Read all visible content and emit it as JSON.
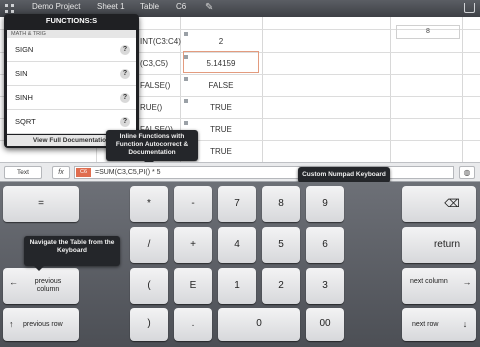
{
  "toolbar": {
    "project": "Demo Project",
    "sheet": "Sheet 1",
    "table": "Table",
    "cell": "C6"
  },
  "sheet": {
    "rows": [
      {
        "formula": "INT(C3:C4)",
        "value": "2"
      },
      {
        "formula": "(C3,C5)",
        "value": "5.14159"
      },
      {
        "formula": "FALSE()",
        "value": "FALSE"
      },
      {
        "formula": "RUE()",
        "value": "TRUE"
      },
      {
        "formula": "FALSE())",
        "value": "TRUE"
      },
      {
        "formula": "",
        "value": "TRUE"
      }
    ],
    "right_value": "8"
  },
  "function_panel": {
    "header": "FUNCTIONS:S",
    "category": "MATH & TRIG",
    "items": [
      {
        "name": "SIGN",
        "help": "?"
      },
      {
        "name": "SIN",
        "help": "?"
      },
      {
        "name": "SINH",
        "help": "?"
      },
      {
        "name": "SQRT",
        "help": "?"
      }
    ],
    "doc_button": "View Full Documentation"
  },
  "callouts": {
    "inline": "Inline Functions with Function Autocorrect & Documentation",
    "numpad": "Custom Numpad Keyboard",
    "navigate": "Navigate the Table from the Keyboard"
  },
  "formula_bar": {
    "text_button": "Text",
    "fx_button": "fx",
    "cell_ref": "C6",
    "formula": "=SUM(C3,C5,PI() * 5"
  },
  "keyboard": {
    "equals": "=",
    "backspace": "⌫",
    "return": "return",
    "previous_column": "previous column",
    "next_column": "next column",
    "previous_row": "previous row",
    "next_row": "next row",
    "keys": {
      "multiply": "*",
      "minus": "-",
      "seven": "7",
      "eight": "8",
      "nine": "9",
      "divide": "/",
      "plus": "+",
      "four": "4",
      "five": "5",
      "six": "6",
      "open_paren": "(",
      "exponent": "E",
      "one": "1",
      "two": "2",
      "three": "3",
      "close_paren": ")",
      "decimal": ".",
      "zero": "0",
      "double_zero": "00"
    }
  },
  "colors": {
    "accent": "#e06d4f",
    "selection_border": "#e39b7e"
  }
}
